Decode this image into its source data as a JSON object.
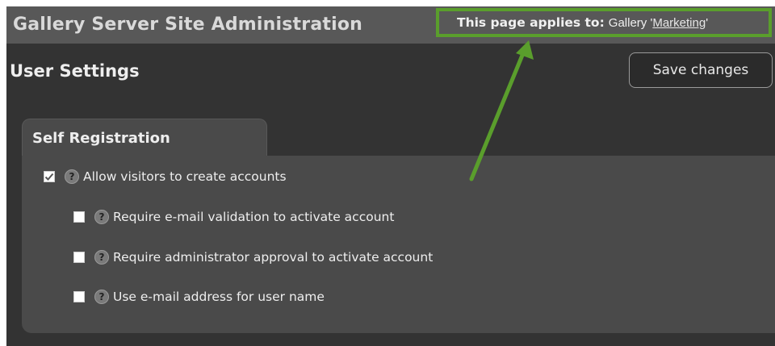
{
  "header": {
    "site_title": "Gallery Server Site Administration",
    "applies_label": "This page applies to:",
    "applies_prefix": "Gallery '",
    "applies_gallery": "Marketing",
    "applies_suffix": "'"
  },
  "page": {
    "title": "User Settings",
    "save_label": "Save changes"
  },
  "self_registration": {
    "title": "Self Registration",
    "options": [
      {
        "label": "Allow visitors to create accounts",
        "checked": true
      },
      {
        "label": "Require e-mail validation to activate account",
        "checked": false
      },
      {
        "label": "Require administrator approval to activate account",
        "checked": false
      },
      {
        "label": "Use e-mail address for user name",
        "checked": false
      }
    ],
    "help_glyph": "?"
  },
  "colors": {
    "highlight": "#5a9e2c",
    "background": "#333333",
    "panel": "#4a4a4a"
  },
  "icons": [
    "help-icon",
    "checkmark-icon",
    "annotation-arrow"
  ]
}
